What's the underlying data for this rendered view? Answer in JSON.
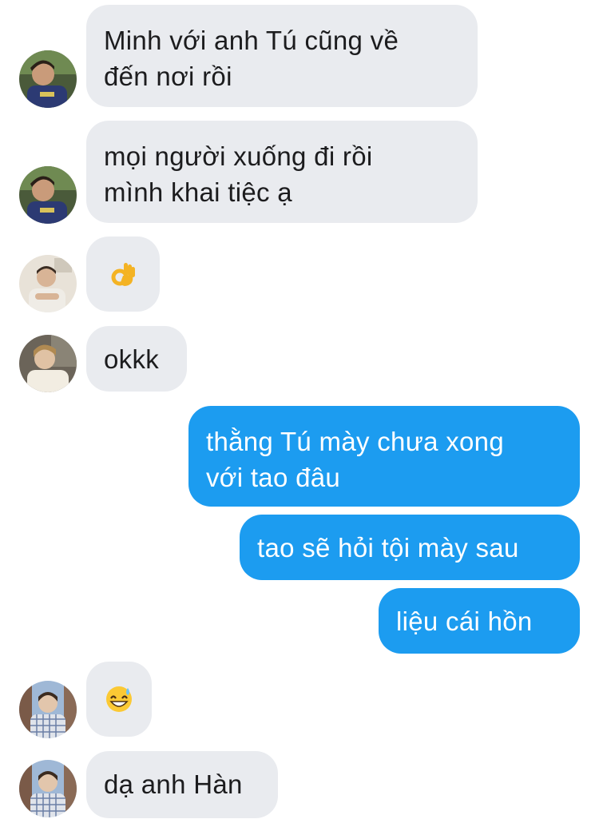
{
  "conversation": {
    "messages": [
      {
        "direction": "incoming",
        "text": "Minh với anh Tú cũng về\nđến nơi rồi",
        "avatar": "avatar-a"
      },
      {
        "direction": "incoming",
        "text": "mọi người xuống đi rồi\nmình khai tiệc ạ",
        "avatar": "avatar-a"
      },
      {
        "direction": "incoming",
        "text": "",
        "emoji": "ok-hand-emoji",
        "avatar": "avatar-b"
      },
      {
        "direction": "incoming",
        "text": "okkk",
        "avatar": "avatar-c"
      },
      {
        "direction": "outgoing",
        "text": "thằng Tú mày chưa xong\nvới tao đâu"
      },
      {
        "direction": "outgoing",
        "text": "tao sẽ hỏi tội mày sau"
      },
      {
        "direction": "outgoing",
        "text": "liệu cái hồn"
      },
      {
        "direction": "incoming",
        "text": "",
        "emoji": "grinning-sweat-emoji",
        "avatar": "avatar-d"
      },
      {
        "direction": "incoming",
        "text": "dạ anh Hàn",
        "avatar": "avatar-d"
      }
    ]
  },
  "colors": {
    "incoming_bubble": "#e9ebef",
    "outgoing_bubble": "#1c9cf0",
    "incoming_text": "#1c1c1e",
    "outgoing_text": "#ffffff"
  }
}
